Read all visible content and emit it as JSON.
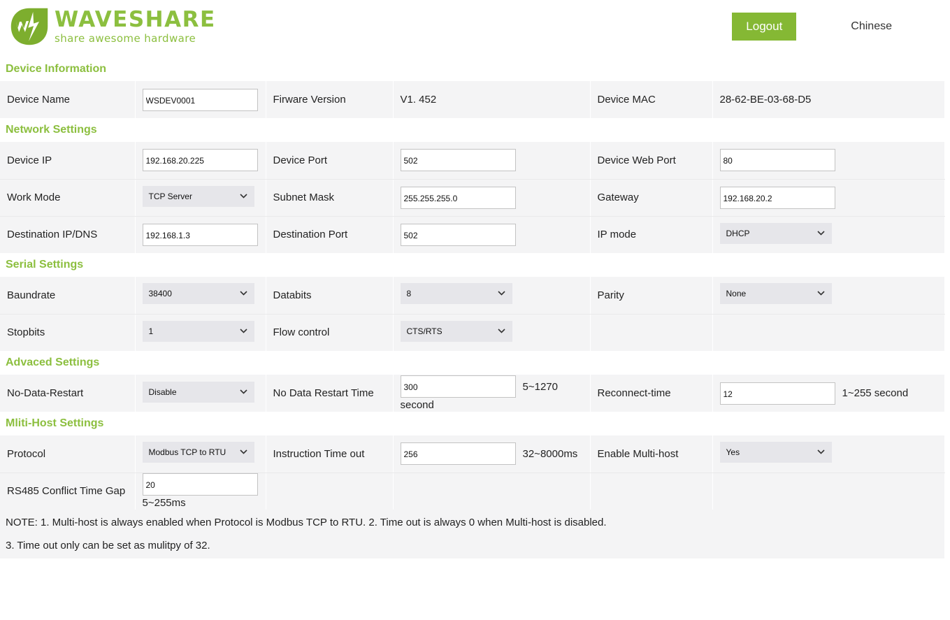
{
  "header": {
    "brand_name": "WAVESHARE",
    "brand_tagline": "share awesome hardware",
    "logout_label": "Logout",
    "language_label": "Chinese",
    "brand_color": "#8cbf3f",
    "button_color": "#85b834"
  },
  "sections": {
    "device_information": {
      "title": "Device Information",
      "device_name_label": "Device Name",
      "device_name_value": "WSDEV0001",
      "firmware_label": "Firware Version",
      "firmware_value": "V1. 452",
      "mac_label": "Device MAC",
      "mac_value": "28-62-BE-03-68-D5"
    },
    "network_settings": {
      "title": "Network Settings",
      "device_ip_label": "Device IP",
      "device_ip_value": "192.168.20.225",
      "device_port_label": "Device Port",
      "device_port_value": "502",
      "web_port_label": "Device Web Port",
      "web_port_value": "80",
      "work_mode_label": "Work Mode",
      "work_mode_value": "TCP Server",
      "subnet_mask_label": "Subnet Mask",
      "subnet_mask_value": "255.255.255.0",
      "gateway_label": "Gateway",
      "gateway_value": "192.168.20.2",
      "dest_ip_label": "Destination IP/DNS",
      "dest_ip_value": "192.168.1.3",
      "dest_port_label": "Destination Port",
      "dest_port_value": "502",
      "ip_mode_label": "IP mode",
      "ip_mode_value": "DHCP"
    },
    "serial_settings": {
      "title": "Serial Settings",
      "baudrate_label": "Baundrate",
      "baudrate_value": "38400",
      "databits_label": "Databits",
      "databits_value": "8",
      "parity_label": "Parity",
      "parity_value": "None",
      "stopbits_label": "Stopbits",
      "stopbits_value": "1",
      "flow_control_label": "Flow control",
      "flow_control_value": "CTS/RTS"
    },
    "advanced_settings": {
      "title": "Advaced Settings",
      "no_data_restart_label": "No-Data-Restart",
      "no_data_restart_value": "Disable",
      "no_data_restart_time_label": "No Data Restart Time",
      "no_data_restart_time_value": "300",
      "no_data_restart_time_range": "5~1270",
      "no_data_restart_time_unit": "second",
      "reconnect_time_label": "Reconnect-time",
      "reconnect_time_value": "12",
      "reconnect_time_range": "1~255 second"
    },
    "multi_host_settings": {
      "title": "Mliti-Host Settings",
      "protocol_label": "Protocol",
      "protocol_value": "Modbus TCP to RTU",
      "instruction_timeout_label": "Instruction Time out",
      "instruction_timeout_value": "256",
      "instruction_timeout_range": "32~8000ms",
      "enable_multihost_label": "Enable Multi-host",
      "enable_multihost_value": "Yes",
      "rs485_gap_label": "RS485 Conflict Time Gap",
      "rs485_gap_value": "20",
      "rs485_gap_range": "5~255ms"
    }
  },
  "note": {
    "line1": "NOTE: 1. Multi-host is always enabled when Protocol is Modbus TCP to RTU. 2. Time out is always 0 when Multi-host is disabled.",
    "line2": "3. Time out only can be set as mulitpy of 32."
  },
  "icons": {
    "chevron": "⌄"
  }
}
